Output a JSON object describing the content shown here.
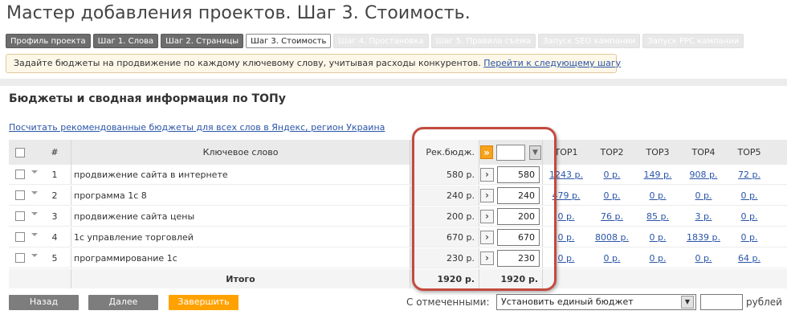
{
  "page": {
    "title": "Мастер добавления проектов. Шаг 3. Стоимость."
  },
  "steps": [
    {
      "label": "Профиль проекта",
      "state": "done"
    },
    {
      "label": "Шаг 1. Слова",
      "state": "done"
    },
    {
      "label": "Шаг 2. Страницы",
      "state": "done"
    },
    {
      "label": "Шаг 3. Стоимость",
      "state": "active"
    },
    {
      "label": "Шаг 4. Простановка",
      "state": "future"
    },
    {
      "label": "Шаг 5. Правила съема",
      "state": "future"
    },
    {
      "label": "Запуск SEO кампании",
      "state": "future"
    },
    {
      "label": "Запуск PPC кампании",
      "state": "future"
    }
  ],
  "hint": {
    "text": "Задайте бюджеты на продвижение по каждому ключевому слову, учитывая расходы конкурентов.",
    "link": "Перейти к следующему шагу"
  },
  "section": {
    "title": "Бюджеты и сводная информация по ТОПу",
    "calc_link": "Посчитать рекомендованные бюджеты для всех слов в Яндекс, регион Украина"
  },
  "table": {
    "headers": {
      "num": "#",
      "keyword": "Ключевое слово",
      "rec_budget": "Рек.бюдж.",
      "top1": "TOP1",
      "top2": "TOP2",
      "top3": "TOP3",
      "top4": "TOP4",
      "top5": "TOP5"
    },
    "rows": [
      {
        "num": "1",
        "keyword": "продвижение сайта в интернете",
        "rec": "580 р.",
        "budget": "580",
        "top1": "1243 р.",
        "top2": "0 р.",
        "top3": "149 р.",
        "top4": "908 р.",
        "top5": "72 р."
      },
      {
        "num": "2",
        "keyword": "программа 1с 8",
        "rec": "240 р.",
        "budget": "240",
        "top1": "479 р.",
        "top2": "0 р.",
        "top3": "0 р.",
        "top4": "0 р.",
        "top5": "0 р."
      },
      {
        "num": "3",
        "keyword": "продвижение сайта цены",
        "rec": "200 р.",
        "budget": "200",
        "top1": "0 р.",
        "top2": "76 р.",
        "top3": "85 р.",
        "top4": "3 р.",
        "top5": "0 р."
      },
      {
        "num": "4",
        "keyword": "1с управление торговлей",
        "rec": "670 р.",
        "budget": "670",
        "top1": "0 р.",
        "top2": "8008 р.",
        "top3": "0 р.",
        "top4": "1839 р.",
        "top5": "0 р."
      },
      {
        "num": "5",
        "keyword": "программирование 1с",
        "rec": "230 р.",
        "budget": "230",
        "top1": "0 р.",
        "top2": "0 р.",
        "top3": "0 р.",
        "top4": "0 р.",
        "top5": "64 р."
      }
    ],
    "total": {
      "label": "Итого",
      "rec": "1920 р.",
      "budget": "1920 р."
    }
  },
  "footer": {
    "back": "Назад",
    "next": "Далее",
    "finish": "Завершить",
    "bulk_label": "С отмеченными:",
    "bulk_option": "Установить единый бюджет",
    "currency": "рублей"
  },
  "colors": {
    "accent": "#ffa200",
    "link": "#2a55a8",
    "highlight": "#c34a3f"
  }
}
